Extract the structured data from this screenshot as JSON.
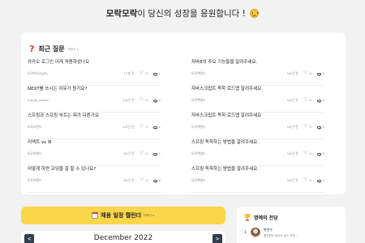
{
  "hero": {
    "brand": "모락모락",
    "text": "이 당신의 성장을 응원합니다 !"
  },
  "recent": {
    "title": "최근 질문",
    "more": "더보기 >",
    "left": [
      {
        "title": "카카오 로그인 어케 적용하셨나요",
        "author": "모락카오Q&Ph",
        "time": "17분 전",
        "likes": "0",
        "comments": "1"
      },
      {
        "title": "NEXT를 쓰시는 이유가 뭔가요?",
        "author": "morak_admin",
        "time": "2시간 전",
        "likes": "0",
        "comments": "2"
      },
      {
        "title": "스프링과 스프링 부트는 뭐가 다른가요",
        "author": "티로프랜드",
        "time": "2시간 전",
        "likes": "0",
        "comments": "1"
      },
      {
        "title": "리액트 vs 뷰",
        "author": "티로프랜드",
        "time": "3시간 전",
        "likes": "0",
        "comments": "1"
      },
      {
        "title": "어떻게 하면 코딩을 잘 할 수 있나요?",
        "author": "티로프랜드",
        "time": "3시간 전",
        "likes": "0",
        "comments": "0"
      }
    ],
    "right": [
      {
        "title": "자바8의 주요 기능들을 알려주세요.",
        "author": "티로백엔드",
        "time": "3시간 전",
        "likes": "0",
        "comments": "0"
      },
      {
        "title": "자바스크립트 독학 로드맵 알려주세요",
        "author": "티로백엔드",
        "time": "3시간 전",
        "likes": "0",
        "comments": "0"
      },
      {
        "title": "자바스크립트 독학 로드맵 알려주세요",
        "author": "티로백엔드",
        "time": "3시간 전",
        "likes": "0",
        "comments": "0"
      },
      {
        "title": "스프링 독학하는 방법을 알려주세요.",
        "author": "티로백엔드",
        "time": "3시간 전",
        "likes": "0",
        "comments": "0"
      },
      {
        "title": "스프링 독학하는 방법을 알려주세요.",
        "author": "티로백엔드",
        "time": "3시간 전",
        "likes": "0",
        "comments": "0"
      }
    ]
  },
  "calendar": {
    "title": "채용 일정 캘린더",
    "more": "더보기 >",
    "month": "December 2022",
    "prev": "<",
    "next": ">"
  },
  "hall": {
    "title": "명예의 전당",
    "rank": "1",
    "name": "박연우",
    "message": "졸업했던 멍이지 않는 하루..."
  }
}
